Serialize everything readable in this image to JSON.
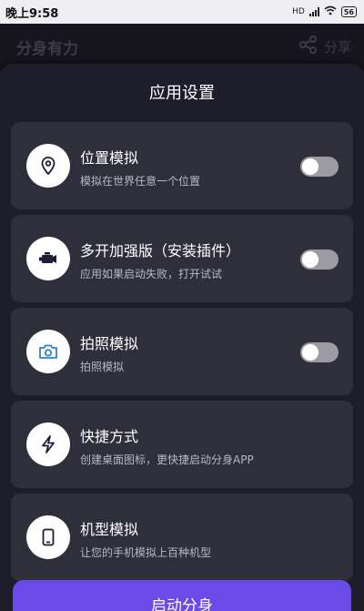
{
  "status_bar": {
    "time": "晚上9:58",
    "network": "HD",
    "battery": "56"
  },
  "background_header": {
    "title": "分身有力",
    "share_label": "分享"
  },
  "sheet": {
    "title": "应用设置",
    "items": [
      {
        "title": "位置模拟",
        "desc": "模拟在世界任意一个位置",
        "icon": "location-pin-icon",
        "has_toggle": true,
        "toggle_on": false
      },
      {
        "title": "多开加强版（安装插件）",
        "desc": "应用如果启动失败，打开试试",
        "icon": "engine-icon",
        "has_toggle": true,
        "toggle_on": false
      },
      {
        "title": "拍照模拟",
        "desc": "拍照模拟",
        "icon": "camera-icon",
        "has_toggle": true,
        "toggle_on": false
      },
      {
        "title": "快捷方式",
        "desc": "创建桌面图标，更快捷启动分身APP",
        "icon": "lightning-icon",
        "has_toggle": false
      },
      {
        "title": "机型模拟",
        "desc": "让您的手机模拟上百种机型",
        "icon": "phone-icon",
        "has_toggle": false
      }
    ],
    "primary_button": "启动分身"
  },
  "colors": {
    "background": "#1b1a24",
    "sheet": "#1e1d2b",
    "card": "#2f2e3b",
    "accent": "#6a4be8",
    "icon_stroke": "#1e1d38",
    "toggle_off": "#9c9ba3"
  }
}
